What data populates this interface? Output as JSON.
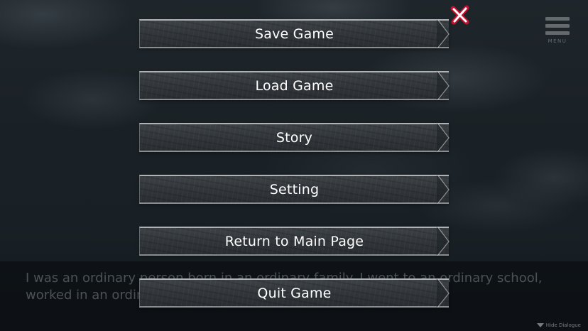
{
  "menu": {
    "items": [
      {
        "label": "Save Game"
      },
      {
        "label": "Load Game"
      },
      {
        "label": "Story"
      },
      {
        "label": "Setting"
      },
      {
        "label": "Return to Main Page"
      },
      {
        "label": "Quit Game"
      }
    ]
  },
  "top_right": {
    "menu_label": "MENU",
    "menu_icon": "hamburger-icon",
    "close_icon": "close-x-icon"
  },
  "dialogue": {
    "text": "I was an ordinary person born in an ordinary family. I went to an ordinary school, worked in an ordinary...",
    "hide_label": "Hide Dialogue"
  },
  "colors": {
    "close_accent": "#c8102e",
    "button_text": "#ffffff"
  }
}
